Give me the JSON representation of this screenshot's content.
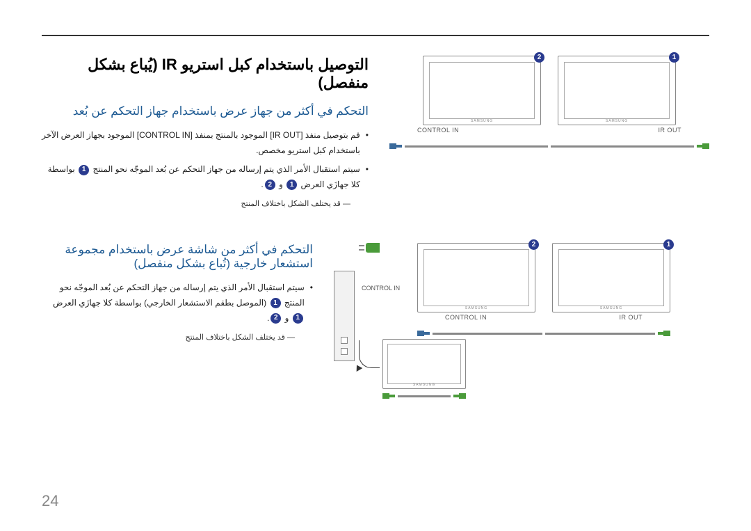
{
  "page_number": "24",
  "badges": {
    "b1": "1",
    "b2": "2"
  },
  "section1": {
    "title": "التوصيل باستخدام كبل استريو IR (يُباع بشكل منفصل)",
    "subheading": "التحكم في أكثر من جهاز عرض باستخدام جهاز التحكم عن بُعد",
    "bullet1": "قم بتوصيل منفذ [IR OUT] الموجود بالمنتج بمنفذ [CONTROL IN] الموجود بجهاز العرض الآخر باستخدام كبل استريو مخصص.",
    "bullet2_prefix": "سيتم استقبال الأمر الذي يتم إرساله من جهاز التحكم عن بُعد الموجّه نحو المنتج",
    "bullet2_suffix": "بواسطة كلا جهازَي العرض",
    "bullet2_conj": "و",
    "footnote": "قد يختلف الشكل باختلاف المنتج"
  },
  "section2": {
    "subheading": "التحكم في أكثر من شاشة عرض باستخدام مجموعة استشعار خارجية (تُباع بشكل منفصل)",
    "bullet1_prefix": "سيتم استقبال الأمر الذي يتم إرساله من جهاز التحكم عن بُعد الموجّه نحو المنتج",
    "bullet1_middle": "(الموصل بطقم الاستشعار الخارجي) بواسطة كلا جهازَي العرض",
    "bullet1_conj": "و",
    "footnote": "قد يختلف الشكل باختلاف المنتج"
  },
  "labels": {
    "ir_out": "IR OUT",
    "control_in": "CONTROL IN",
    "brand": "SAMSUNG"
  }
}
